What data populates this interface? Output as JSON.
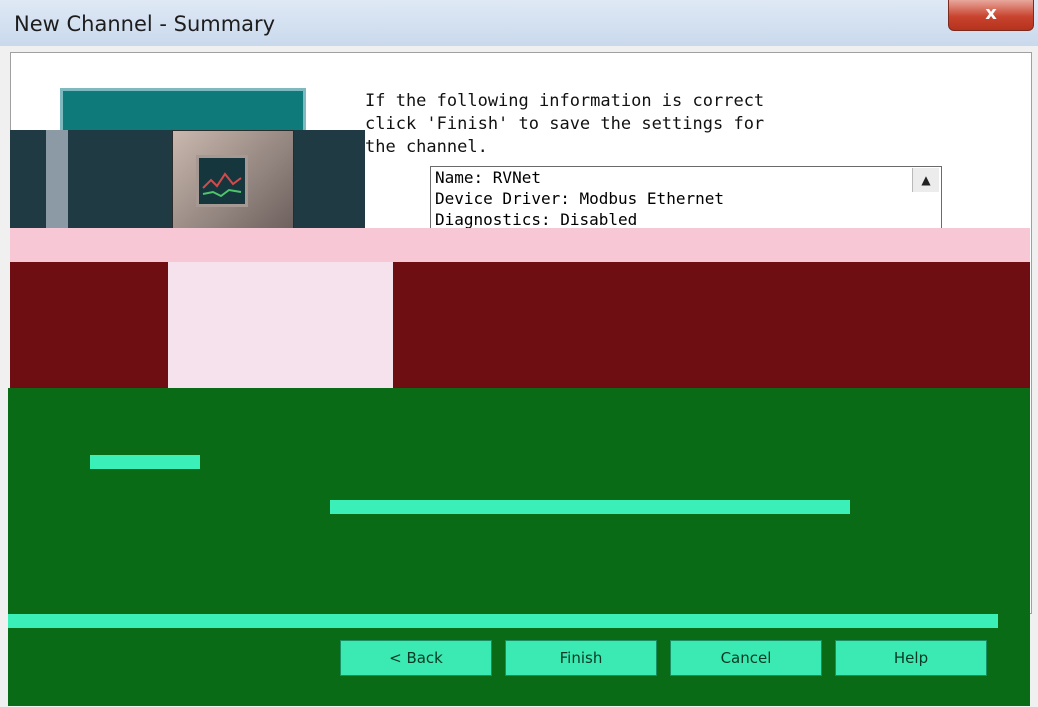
{
  "window": {
    "title": "New Channel - Summary",
    "close_glyph": "x"
  },
  "intro": {
    "text": "If the following information is correct\nclick 'Finish' to save the settings for\nthe channel."
  },
  "summary": {
    "lines": [
      "Name: RVNet",
      "Device Driver: Modbus Ethernet",
      "Diagnostics: Disabled"
    ],
    "scroll_up_glyph": "▲"
  },
  "buttons": {
    "back": "< Back",
    "finish": "Finish",
    "cancel": "Cancel",
    "help": "Help"
  },
  "colors": {
    "panel_teal": "#0f7a7a",
    "corruption_maroon": "#6e0d12",
    "corruption_green": "#0a6b17",
    "corruption_cyan": "#3bf0b8"
  }
}
